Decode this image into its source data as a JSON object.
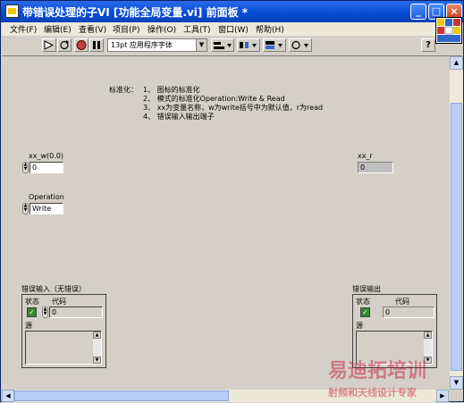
{
  "window": {
    "title": "带错误处理的子VI [功能全局变量.vi] 前面板 *",
    "min_glyph": "_",
    "max_glyph": "□",
    "close_glyph": "×"
  },
  "menu": [
    "文件(F)",
    "编辑(E)",
    "查看(V)",
    "项目(P)",
    "操作(O)",
    "工具(T)",
    "窗口(W)",
    "帮助(H)"
  ],
  "toolbar": {
    "font": "13pt 应用程序字体",
    "dropdown_glyph": "▼",
    "help_glyph": "?"
  },
  "note": {
    "heading": "标准化：",
    "lines": [
      "1、 图标的标准化",
      "2、 模式的标准化Operation:Write & Read",
      "3、 xx为变量名称，w为write括号中为默认值，r为read",
      "4、 错误输入输出端子"
    ]
  },
  "controls": {
    "xx_w_label": "xx_w(0.0)",
    "xx_w_value": "0",
    "operation_label": "Operation",
    "operation_value": "Write",
    "xx_r_label": "xx_r",
    "xx_r_value": "0"
  },
  "error_in": {
    "label": "错误输入（无错误）",
    "status_label": "状态",
    "code_label": "代码",
    "check": "✓",
    "code_value": "0",
    "source_label": "源"
  },
  "error_out": {
    "label": "错误输出",
    "status_label": "状态",
    "code_label": "代码",
    "check": "✓",
    "code_value": "0",
    "source_label": "源"
  },
  "watermark": {
    "line1": "易迪拓培训",
    "line2": "射频和天线设计专家"
  },
  "colors": {
    "titlebar": "#0a4fd8",
    "panel": "#d4d0c8",
    "status_ok": "#2e8b2e",
    "watermark": "#c8102e"
  }
}
